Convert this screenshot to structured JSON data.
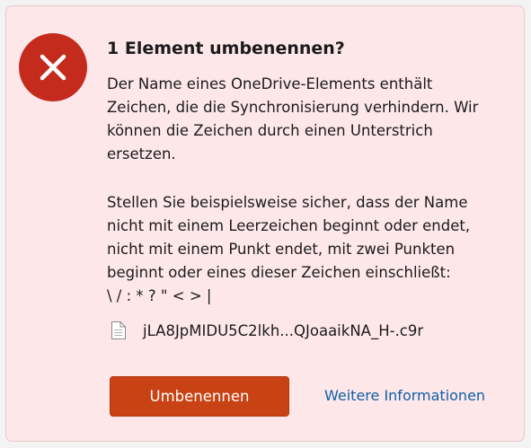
{
  "dialog": {
    "title": "1 Element umbenennen?",
    "paragraph1": "Der Name eines OneDrive-Elements enthält\nZeichen, die die Synchronisierung verhindern. Wir\nkönnen die Zeichen durch einen Unterstrich\nersetzen.",
    "paragraph2": "Stellen Sie beispielsweise sicher, dass der Name\nnicht mit einem Leerzeichen beginnt oder endet,\nnicht mit einem Punkt endet, mit zwei Punkten\nbeginnt oder eines dieser Zeichen einschließt:\n\\ / : * ? \" < > |",
    "file_name": "jLA8JpMIDU5C2lkh...QJoaaikNA_H-.c9r",
    "primary_button_label": "Umbenennen",
    "link_label": "Weitere Informationen",
    "icons": {
      "status": "error-x-icon",
      "file": "document-icon"
    },
    "colors": {
      "background": "#fde7e9",
      "error": "#c42b1c",
      "primary_button": "#c94213",
      "link": "#0f5fa8"
    }
  }
}
